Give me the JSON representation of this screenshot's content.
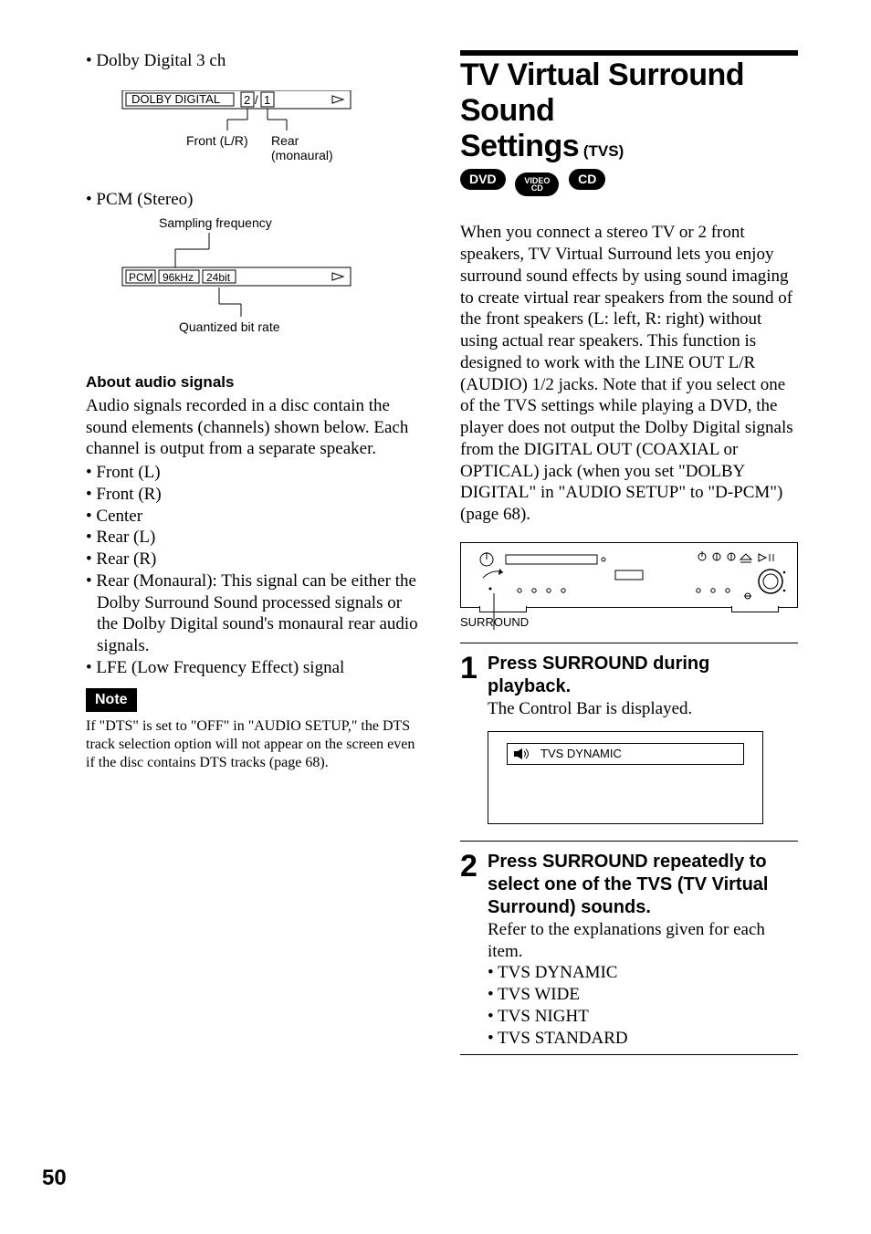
{
  "left": {
    "dd3ch": "• Dolby Digital 3 ch",
    "diagram1": {
      "box": "DOLBY DIGITAL",
      "n1": "2",
      "slash": "/",
      "n2": "1",
      "front": "Front (L/R)",
      "rear": "Rear",
      "mono": "(monaural)"
    },
    "pcm_stereo": "• PCM (Stereo)",
    "diagram2": {
      "sampling": "Sampling frequency",
      "pcm": "PCM",
      "freq": "96kHz",
      "bit": "24bit",
      "qbr": "Quantized bit rate"
    },
    "about_title": "About audio signals",
    "about_p1": "Audio signals recorded in a disc contain the sound elements (channels) shown below. Each channel is output from a separate speaker.",
    "chs": [
      "• Front (L)",
      "• Front (R)",
      "• Center",
      "• Rear (L)",
      "• Rear (R)",
      "• Rear (Monaural): This signal can be either the Dolby Surround Sound processed signals or the Dolby Digital sound's monaural rear audio signals.",
      "• LFE (Low Frequency Effect) signal"
    ],
    "note_label": "Note",
    "note_text": "If \"DTS\" is set to \"OFF\" in \"AUDIO SETUP,\" the DTS track selection option will not appear on the screen even if the disc contains DTS tracks (page 68)."
  },
  "right": {
    "title1": "TV Virtual Surround Sound",
    "title2": "Settings",
    "tvs": "(TVS)",
    "pills": {
      "dvd": "DVD",
      "video": "VIDEO\nCD",
      "cd": "CD"
    },
    "body_p": "When you connect a stereo TV or 2 front speakers, TV Virtual Surround lets you enjoy surround sound effects by using sound imaging to create virtual rear speakers from the sound of the front speakers (L: left, R: right) without using actual rear speakers. This function is designed to work with the LINE OUT L/R (AUDIO) 1/2 jacks. Note that if you select one of the TVS settings while playing a DVD, the player does not output the Dolby Digital signals from the DIGITAL OUT (COAXIAL or OPTICAL) jack (when you set \"DOLBY DIGITAL\" in \"AUDIO SETUP\" to \"D-PCM\") (page 68).",
    "surround_label": "SURROUND",
    "step1": {
      "num": "1",
      "title": "Press SURROUND during playback.",
      "body": "The Control Bar is displayed.",
      "ctrl_text": "TVS DYNAMIC"
    },
    "step2": {
      "num": "2",
      "title": "Press SURROUND repeatedly to select one of the TVS (TV Virtual Surround) sounds.",
      "body": "Refer to the explanations given for each item.",
      "items": [
        "• TVS DYNAMIC",
        "• TVS WIDE",
        "• TVS NIGHT",
        "• TVS STANDARD"
      ]
    }
  },
  "page_number": "50"
}
